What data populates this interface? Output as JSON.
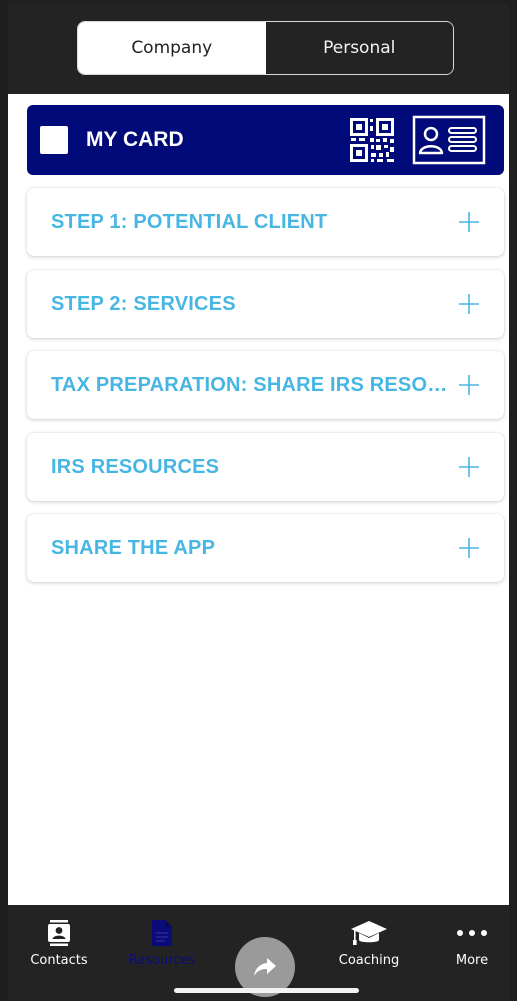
{
  "segments": {
    "company": "Company",
    "personal": "Personal",
    "selected": "Company"
  },
  "my_card": {
    "title": "MY CARD",
    "icons": [
      "qr-code-icon",
      "id-card-icon"
    ]
  },
  "accordion": [
    {
      "label": "STEP 1: POTENTIAL CLIENT"
    },
    {
      "label": "STEP 2: SERVICES"
    },
    {
      "label": "TAX PREPARATION: SHARE IRS RESOUR..."
    },
    {
      "label": "IRS RESOURCES"
    },
    {
      "label": "SHARE THE APP"
    }
  ],
  "tabbar": {
    "contacts": "Contacts",
    "resources": "Resources",
    "coaching": "Coaching",
    "more": "More",
    "active": "Resources"
  },
  "colors": {
    "header_bg": "#232323",
    "card_bg": "#000a78",
    "accent": "#48b6e3",
    "active_tab": "#0b0c7a"
  }
}
